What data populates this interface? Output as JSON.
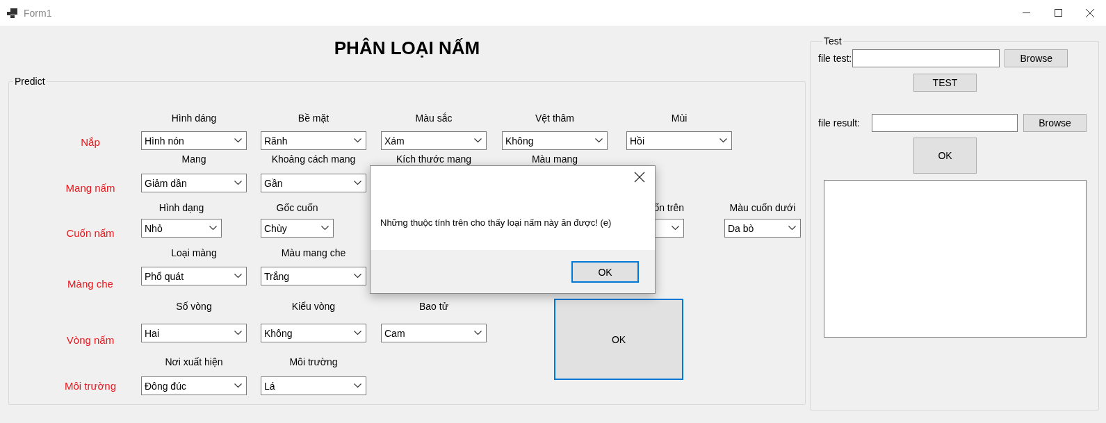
{
  "window": {
    "title": "Form1"
  },
  "heading": "PHÂN LOẠI NẤM",
  "predict": {
    "title": "Predict",
    "rows": [
      {
        "label": "Nắp",
        "fields": [
          {
            "kind": "combo",
            "label": "Hình dáng",
            "value": "Hình nón"
          },
          {
            "kind": "combo",
            "label": "Bề mặt",
            "value": "Rãnh"
          },
          {
            "kind": "combo",
            "label": "Màu sắc",
            "value": "Xám"
          },
          {
            "kind": "combo",
            "label": "Vệt thâm",
            "value": "Không"
          },
          {
            "kind": "combo",
            "label": "Mùi",
            "value": "Hồi"
          }
        ]
      },
      {
        "label": "Mang nấm",
        "fields": [
          {
            "kind": "combo",
            "label": "Mang",
            "value": "Giảm dần"
          },
          {
            "kind": "combo",
            "label": "Khoảng cách mang",
            "value": "Gần"
          },
          {
            "kind": "caption",
            "label": "Kích thước mang"
          },
          {
            "kind": "caption",
            "label": "Màu mang"
          }
        ]
      },
      {
        "label": "Cuốn nấm",
        "fields": [
          {
            "kind": "combo",
            "label": "Hình dạng",
            "value": "Nhỏ"
          },
          {
            "kind": "combo",
            "label": "Gốc cuốn",
            "value": "Chùy"
          },
          {
            "kind": "combo",
            "label": "ốn trên"
          },
          {
            "kind": "combo",
            "label": "Màu cuốn dưới",
            "value": "Da bò"
          }
        ]
      },
      {
        "label": "Màng che",
        "fields": [
          {
            "kind": "combo",
            "label": "Loại màng",
            "value": "Phổ quát"
          },
          {
            "kind": "combo",
            "label": "Màu mang che",
            "value": "Trắng"
          }
        ]
      },
      {
        "label": "Vòng nấm",
        "fields": [
          {
            "kind": "combo",
            "label": "Số vòng",
            "value": "Hai"
          },
          {
            "kind": "combo",
            "label": "Kiểu vòng",
            "value": "Không"
          },
          {
            "kind": "combo",
            "label": "Bao tử",
            "value": "Cam"
          }
        ]
      },
      {
        "label": "Môi trường",
        "fields": [
          {
            "kind": "combo",
            "label": "Nơi xuất hiện",
            "value": "Đông đúc"
          },
          {
            "kind": "combo",
            "label": "Môi trường",
            "value": "Lá"
          }
        ]
      }
    ],
    "button": {
      "label": "OK",
      "focused": true
    }
  },
  "test": {
    "title": "Test",
    "file_test": {
      "label": "file test:",
      "browse": "Browse"
    },
    "test_button": "TEST",
    "file_result": {
      "label": "file result:",
      "browse": "Browse"
    },
    "ok_button": "OK"
  },
  "dialog": {
    "message": "Những thuộc tính trên cho thấy loại nấm này ăn được! (e)",
    "ok": {
      "label": "OK",
      "focused": true
    }
  }
}
